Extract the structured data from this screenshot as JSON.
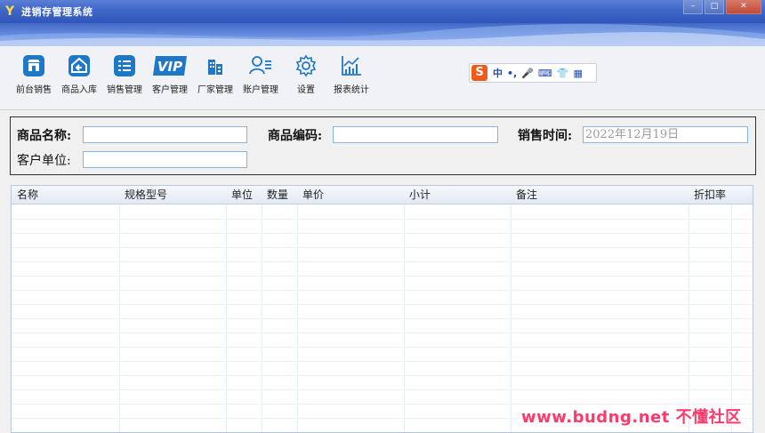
{
  "window": {
    "title": "进销存管理系统",
    "app_icon_glyph": "Y",
    "buttons": {
      "minimize": "–",
      "maximize": "□",
      "close": "✕"
    }
  },
  "toolbar": {
    "items": [
      {
        "label": "前台销售",
        "icon": "storefront-icon"
      },
      {
        "label": "商品入库",
        "icon": "warehouse-in-icon"
      },
      {
        "label": "销售管理",
        "icon": "list-icon"
      },
      {
        "label": "客户管理",
        "icon": "vip-icon"
      },
      {
        "label": "厂家管理",
        "icon": "building-icon"
      },
      {
        "label": "账户管理",
        "icon": "user-list-icon"
      },
      {
        "label": "设置",
        "icon": "gear-icon"
      },
      {
        "label": "报表统计",
        "icon": "chart-icon"
      }
    ],
    "vip_text": "VIP"
  },
  "ime": {
    "logo": "S",
    "items": [
      "中",
      "•,",
      "🎤",
      "⌨",
      "👕",
      "▦"
    ]
  },
  "form": {
    "product_name_label": "商品名称:",
    "product_name_value": "",
    "product_code_label": "商品编码:",
    "product_code_value": "",
    "sale_time_label": "销售时间:",
    "sale_time_value": "2022年12月19日",
    "customer_label": "客户单位:",
    "customer_value": ""
  },
  "grid": {
    "columns": [
      "名称",
      "规格型号",
      "单位",
      "数量",
      "单价",
      "小计",
      "备注",
      "折扣率"
    ]
  },
  "watermark": "www.budng.net 不懂社区",
  "colors": {
    "titlebar": "#3e66c8",
    "icon_blue": "#1e78c8",
    "watermark": "#ff3a6a"
  }
}
